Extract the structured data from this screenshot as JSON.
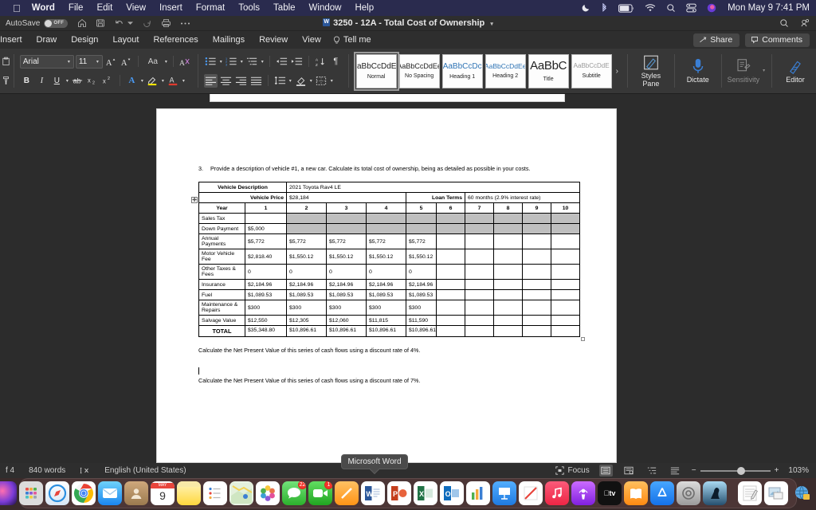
{
  "macbar": {
    "apple": "apple-logo",
    "menus": [
      "Word",
      "File",
      "Edit",
      "View",
      "Insert",
      "Format",
      "Tools",
      "Table",
      "Window",
      "Help"
    ],
    "status_icons": [
      "moon-icon",
      "bluetooth-icon",
      "battery-charging-icon",
      "wifi-icon",
      "search-icon",
      "control-center-icon",
      "siri-icon"
    ],
    "clock": "Mon May 9  7:41 PM"
  },
  "titlebar": {
    "autosave_label": "AutoSave",
    "autosave_state": "OFF",
    "quick_icons": [
      "home-icon",
      "save-icon",
      "undo-icon",
      "undo-dropdown-icon",
      "redo-icon",
      "print-icon",
      "more-icon"
    ],
    "document_title": "3250 - 12A - Total Cost of Ownership",
    "title_dropdown": "chevron-down-icon",
    "right_icons": [
      "search-icon",
      "collaborate-icon"
    ]
  },
  "ribbon_tabs": {
    "tabs": [
      "Insert",
      "Draw",
      "Design",
      "Layout",
      "References",
      "Mailings",
      "Review",
      "View"
    ],
    "tell_me": "Tell me",
    "share": "Share",
    "comments": "Comments"
  },
  "ribbon": {
    "font_name": "Arial",
    "font_size": "11",
    "grow_font": "A",
    "shrink_font": "A",
    "change_case": "Aa",
    "clear_formatting": "clear-formatting-icon",
    "bold": "B",
    "italic": "I",
    "underline": "U",
    "strikethrough": "strikethrough-icon",
    "subscript": "x₂",
    "superscript": "x²",
    "text_effects": "A",
    "highlight": "A",
    "font_color": "A",
    "paragraph_icons": [
      "bullets-icon",
      "numbering-icon",
      "multilevel-list-icon",
      "decrease-indent-icon",
      "increase-indent-icon",
      "sort-icon",
      "show-marks-icon"
    ],
    "align_icons": [
      "align-left-icon",
      "align-center-icon",
      "align-right-icon",
      "justify-icon",
      "line-spacing-icon",
      "shading-icon",
      "borders-icon"
    ],
    "styles": [
      {
        "sample": "AaBbCcDdEe",
        "name": "Normal",
        "kind": "normal",
        "active": true
      },
      {
        "sample": "AaBbCcDdEe",
        "name": "No Spacing",
        "kind": "nsp",
        "active": false
      },
      {
        "sample": "AaBbCcDc",
        "name": "Heading 1",
        "kind": "h1",
        "active": false
      },
      {
        "sample": "AaBbCcDdEe",
        "name": "Heading 2",
        "kind": "h2",
        "active": false
      },
      {
        "sample": "AaBbC",
        "name": "Title",
        "kind": "title",
        "active": false
      },
      {
        "sample": "AaBbCcDdE",
        "name": "Subtitle",
        "kind": "sub",
        "active": false
      }
    ],
    "gallery_more": "›",
    "styles_pane": "Styles\nPane",
    "styles_pane_l1": "Styles",
    "styles_pane_l2": "Pane",
    "dictate": "Dictate",
    "sensitivity": "Sensitivity",
    "editor": "Editor"
  },
  "document": {
    "question_number": "3.",
    "question_text": "Provide a description of vehicle #1, a new car. Calculate its total cost of ownership, being as detailed as possible in your costs.",
    "table": {
      "vehicle_description_label": "Vehicle Description",
      "vehicle_description_value": "2021 Toyota Rav4 LE",
      "vehicle_price_label": "Vehicle Price",
      "vehicle_price_value": "$28,184",
      "loan_terms_label": "Loan Terms",
      "loan_terms_value": "60 months (2.9% interest rate)",
      "year_label": "Year",
      "years": [
        "1",
        "2",
        "3",
        "4",
        "5",
        "6",
        "7",
        "8",
        "9",
        "10"
      ],
      "rows": [
        {
          "label": "Sales Tax",
          "values": [
            "",
            "",
            "",
            "",
            ""
          ],
          "shaded_from": 1
        },
        {
          "label": "Down Payment",
          "values": [
            "$5,000",
            "",
            "",
            "",
            ""
          ],
          "shaded_from": 1
        },
        {
          "label": "Annual Payments",
          "values": [
            "$5,772",
            "$5,772",
            "$5,772",
            "$5,772",
            "$5,772"
          ],
          "shaded_from": 99
        },
        {
          "label": "Motor Vehicle Fee",
          "values": [
            "$2,818.40",
            "$1,550.12",
            "$1,550.12",
            "$1,550.12",
            "$1,550.12"
          ],
          "shaded_from": 99
        },
        {
          "label": "Other Taxes & Fees",
          "values": [
            "0",
            "0",
            "0",
            "0",
            "0"
          ],
          "shaded_from": 99
        },
        {
          "label": "Insurance",
          "values": [
            "$2,184.96",
            "$2,184.96",
            "$2,184.96",
            "$2,184.96",
            "$2,184.96"
          ],
          "shaded_from": 99
        },
        {
          "label": "Fuel",
          "values": [
            "$1,089.53",
            "$1,089.53",
            "$1,089.53",
            "$1,089.53",
            "$1,089.53"
          ],
          "shaded_from": 99
        },
        {
          "label": "Maintenance & Repairs",
          "values": [
            "$300",
            "$300",
            "$300",
            "$300",
            "$300"
          ],
          "shaded_from": 99
        },
        {
          "label": "Salvage Value",
          "values": [
            "$12,550",
            "$12,305",
            "$12,060",
            "$11,815",
            "$11,590"
          ],
          "shaded_from": 99
        },
        {
          "label": "TOTAL",
          "values": [
            "$35,348.80",
            "$10,896.61",
            "$10,896.61",
            "$10,896.61",
            "$10,896.61"
          ],
          "shaded_from": 99
        }
      ]
    },
    "para_npv_4": "Calculate the Net Present Value of this series of cash flows using a discount rate of 4%.",
    "para_npv_7": "Calculate the Net Present Value of this series of cash flows using a discount rate of 7%."
  },
  "tooltip": {
    "text": "Microsoft Word"
  },
  "statusbar": {
    "page_count": "f 4",
    "word_count": "840 words",
    "proofing_icon": "proofing-errors-icon",
    "language": "English (United States)",
    "focus": "Focus",
    "view_icons": [
      "print-layout-icon",
      "web-layout-icon",
      "outline-icon",
      "draft-icon"
    ],
    "zoom_minus": "−",
    "zoom_plus": "+",
    "zoom_level": "103%"
  },
  "dock": {
    "items": [
      {
        "name": "finder",
        "glyph": "☺",
        "bg": "linear-gradient(#39b7f5,#1d8fe0)",
        "dot": true
      },
      {
        "name": "siri",
        "glyph": "",
        "bg": "radial-gradient(circle at 40% 40%,#ff5fa2,#6a3bd6 60%,#1c1147)",
        "dot": false
      },
      {
        "name": "launchpad",
        "glyph": "",
        "bg": "#d9d9d9",
        "dot": false
      },
      {
        "name": "safari",
        "glyph": "✶",
        "bg": "linear-gradient(#f4f7fb,#cfe0f2)",
        "dot": false
      },
      {
        "name": "chrome",
        "glyph": "",
        "bg": "#fff",
        "dot": true
      },
      {
        "name": "mail",
        "glyph": "✉",
        "bg": "linear-gradient(#5ac8fa,#1f93f0)",
        "dot": false
      },
      {
        "name": "contacts",
        "glyph": "●",
        "bg": "linear-gradient(#caa579,#9d7a4e)",
        "dot": false
      },
      {
        "name": "calendar",
        "glyph": "9",
        "bg": "#fff",
        "dot": false
      },
      {
        "name": "notes",
        "glyph": "",
        "bg": "linear-gradient(#fff2b0,#ffd94a)",
        "dot": false
      },
      {
        "name": "reminders",
        "glyph": "",
        "bg": "#fff",
        "dot": false
      },
      {
        "name": "maps",
        "glyph": "",
        "bg": "#e8f3e2",
        "dot": false
      },
      {
        "name": "photos",
        "glyph": "",
        "bg": "#fff",
        "dot": false
      },
      {
        "name": "messages",
        "glyph": "●",
        "bg": "linear-gradient(#6ee26e,#2cb12c)",
        "dot": false,
        "badge": "22"
      },
      {
        "name": "facetime",
        "glyph": "▶",
        "bg": "linear-gradient(#5ddb5d,#26a826)",
        "dot": false,
        "badge": "1"
      },
      {
        "name": "freeform",
        "glyph": "╱",
        "bg": "linear-gradient(#ffb74d,#ff9800)",
        "dot": false
      },
      {
        "name": "word",
        "glyph": "W",
        "bg": "#fff",
        "dot": true
      },
      {
        "name": "powerpoint",
        "glyph": "P",
        "bg": "#fff",
        "dot": false
      },
      {
        "name": "excel",
        "glyph": "X",
        "bg": "#fff",
        "dot": false
      },
      {
        "name": "outlook",
        "glyph": "O",
        "bg": "#fff",
        "dot": false
      },
      {
        "name": "numbers",
        "glyph": "",
        "bg": "#fff",
        "dot": false
      },
      {
        "name": "keynote",
        "glyph": "",
        "bg": "linear-gradient(#4aa8ff,#1f7ae0)",
        "dot": false
      },
      {
        "name": "pages",
        "glyph": "✐",
        "bg": "#fff",
        "dot": false
      },
      {
        "name": "music",
        "glyph": "♫",
        "bg": "linear-gradient(#fc5c7d,#f0294a)",
        "dot": false
      },
      {
        "name": "podcasts",
        "glyph": "◉",
        "bg": "linear-gradient(#c56bff,#8e2de2)",
        "dot": false
      },
      {
        "name": "appletv",
        "glyph": "tv",
        "bg": "#111",
        "dot": false
      },
      {
        "name": "books",
        "glyph": "◖",
        "bg": "linear-gradient(#ffb347,#ff8c1a)",
        "dot": false
      },
      {
        "name": "appstore",
        "glyph": "A",
        "bg": "linear-gradient(#3ea0ff,#1576e8)",
        "dot": false
      },
      {
        "name": "system-settings",
        "glyph": "⚙",
        "bg": "linear-gradient(#d7d7d7,#9a9a9a)",
        "dot": false
      },
      {
        "name": "kindle",
        "glyph": "",
        "bg": "linear-gradient(#7ec8f0,#2a4f6e)",
        "dot": false
      },
      {
        "name": "textedit",
        "glyph": "✎",
        "bg": "#fff",
        "dot": false
      },
      {
        "name": "preview",
        "glyph": "",
        "bg": "#fff",
        "dot": false
      },
      {
        "name": "file-sharing",
        "glyph": "ἱ0",
        "bg": "transparent",
        "dot": false
      },
      {
        "name": "trash",
        "glyph": "",
        "bg": "transparent",
        "dot": false
      }
    ]
  }
}
